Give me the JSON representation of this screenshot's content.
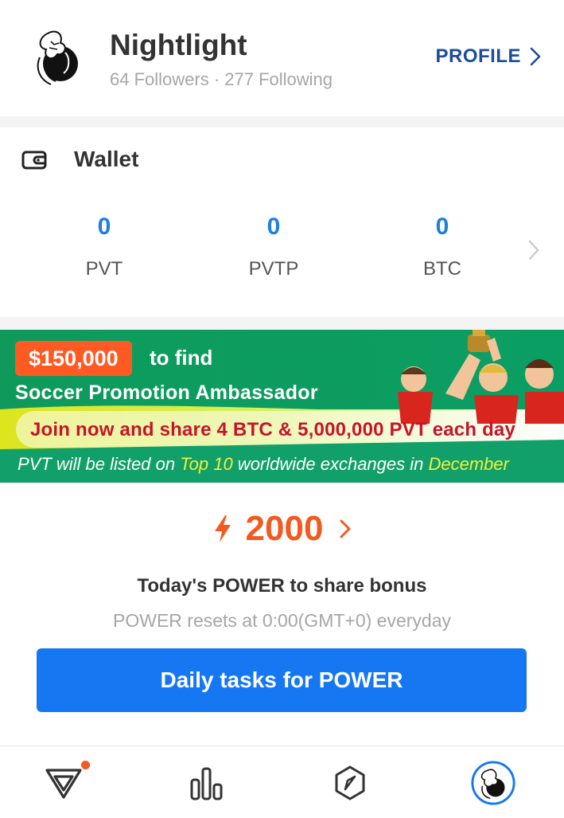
{
  "profile": {
    "name": "Nightlight",
    "followers_text": "64 Followers · 277 Following",
    "profile_link_label": "PROFILE"
  },
  "wallet": {
    "title": "Wallet",
    "coins": [
      {
        "value": "0",
        "name": "PVT"
      },
      {
        "value": "0",
        "name": "PVTP"
      },
      {
        "value": "0",
        "name": "BTC"
      }
    ]
  },
  "banner": {
    "prize": "$150,000",
    "to_find": "to find",
    "ambassador": "Soccer Promotion Ambassador",
    "join": "Join now and share 4 BTC & 5,000,000 PVT each day",
    "listed_1": "PVT will be listed on ",
    "listed_hl_1": "Top 10",
    "listed_2": " worldwide exchanges in ",
    "listed_hl_2": "December"
  },
  "power": {
    "value": "2000",
    "title": "Today's POWER to share bonus",
    "subtitle": "POWER resets at 0:00(GMT+0) everyday",
    "cta_label": "Daily tasks for POWER"
  },
  "tabbar": {
    "items": [
      {
        "icon": "home-v-icon",
        "active": false,
        "badge": true
      },
      {
        "icon": "chart-bars-icon",
        "active": false,
        "badge": false
      },
      {
        "icon": "compass-icon",
        "active": false,
        "badge": false
      },
      {
        "icon": "avatar-icon",
        "active": true,
        "badge": false
      }
    ]
  },
  "colors": {
    "accent_blue": "#1677f2",
    "value_blue": "#1d7fe0",
    "profile_blue": "#1b4d9a",
    "power_orange": "#f35a1f",
    "banner_green": "#0c9b5e"
  }
}
